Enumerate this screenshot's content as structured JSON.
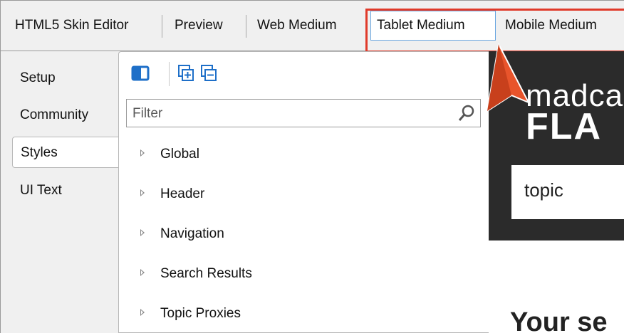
{
  "top_tabs": [
    {
      "label": "HTML5 Skin Editor"
    },
    {
      "label": "Preview"
    },
    {
      "label": "Web Medium"
    },
    {
      "label": "Tablet Medium"
    },
    {
      "label": "Mobile Medium"
    }
  ],
  "active_top_tab": "Tablet Medium",
  "left_tabs": [
    {
      "label": "Setup"
    },
    {
      "label": "Community"
    },
    {
      "label": "Styles"
    },
    {
      "label": "UI Text"
    }
  ],
  "active_left_tab": "Styles",
  "toolbar": {
    "icons": [
      "panel-toggle-icon",
      "expand-all-icon",
      "collapse-all-icon"
    ]
  },
  "filter": {
    "placeholder": "Filter",
    "value": ""
  },
  "tree": [
    {
      "label": "Global"
    },
    {
      "label": "Header"
    },
    {
      "label": "Navigation"
    },
    {
      "label": "Search Results"
    },
    {
      "label": "Topic Proxies"
    }
  ],
  "preview": {
    "logo_line1": "madca",
    "logo_line2": "FLA",
    "search_text": "topic",
    "heading": "Your se"
  },
  "colors": {
    "highlight": "#e03a2a",
    "callout": "#e8542b",
    "active_tab_border": "#6aa6e0",
    "preview_header": "#2b2b2b",
    "icon_blue": "#1e6fc8"
  }
}
